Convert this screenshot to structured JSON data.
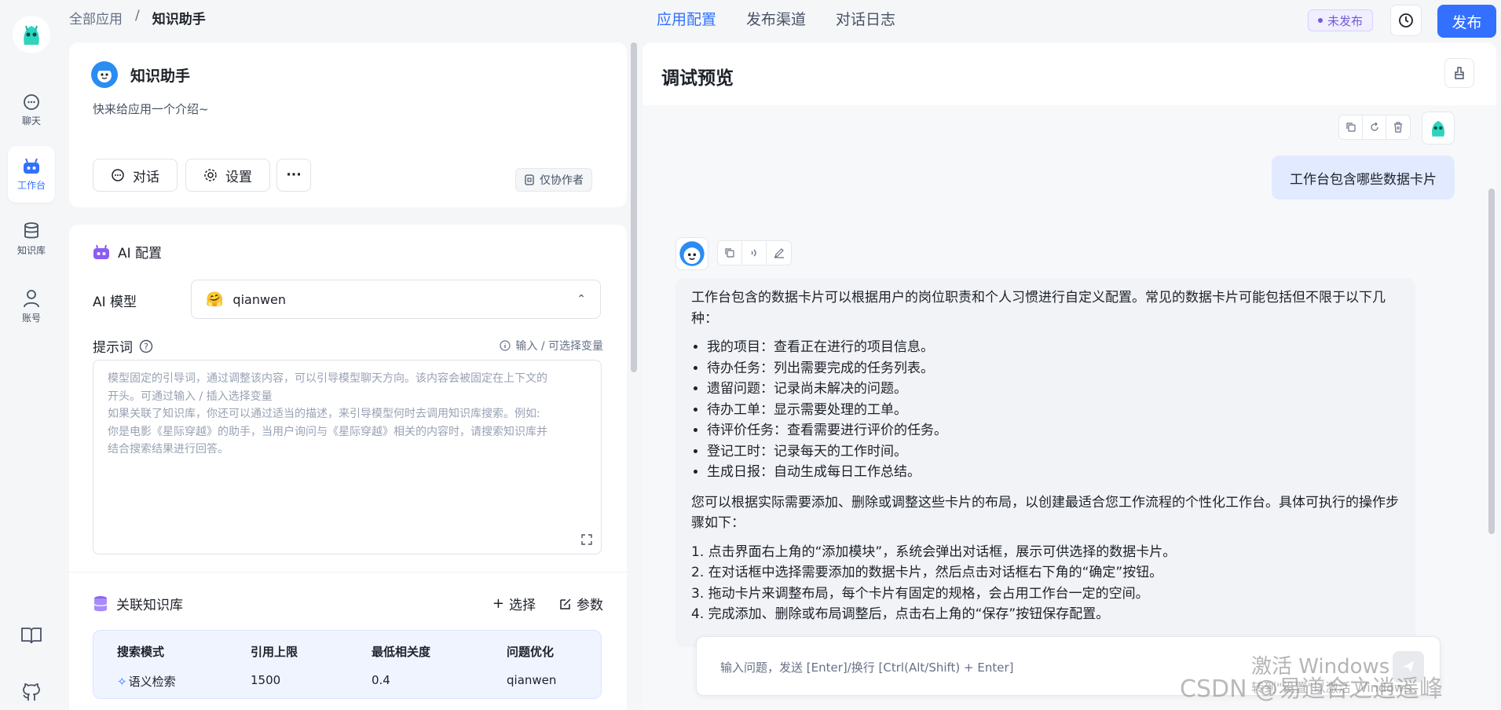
{
  "nav": {
    "items": [
      {
        "label": "聊天",
        "icon": "chat-icon"
      },
      {
        "label": "工作台",
        "icon": "robot-icon",
        "active": true
      },
      {
        "label": "知识库",
        "icon": "database-icon"
      },
      {
        "label": "账号",
        "icon": "user-icon"
      }
    ],
    "bottom_icons": [
      "book-icon",
      "github-icon"
    ]
  },
  "breadcrumb": {
    "root": "全部应用",
    "separator": "/",
    "current": "知识助手"
  },
  "top_tabs": [
    "应用配置",
    "发布渠道",
    "对话日志"
  ],
  "status": "未发布",
  "publish_label": "发布",
  "app": {
    "name": "知识助手",
    "description": "快来给应用一个介绍~",
    "buttons": {
      "chat": "对话",
      "settings": "设置",
      "more": "···"
    },
    "coauthor": "仅协作者"
  },
  "ai_config": {
    "title": "AI 配置",
    "model_label": "AI 模型",
    "model_value": "qianwen",
    "prompt_label": "提示词",
    "var_hint": "输入 / 可选择变量",
    "prompt_placeholder_1": "模型固定的引导词，通过调整该内容，可以引导模型聊天方向。该内容会被固定在上下文的",
    "prompt_placeholder_2": "开头。可通过输入 / 插入选择变量",
    "prompt_placeholder_3": "如果关联了知识库，你还可以通过适当的描述，来引导模型何时去调用知识库搜索。例如:",
    "prompt_placeholder_4": "你是电影《星际穿越》的助手，当用户询问与《星际穿越》相关的内容时，请搜索知识库并",
    "prompt_placeholder_5": "结合搜索结果进行回答。"
  },
  "knowledge": {
    "title": "关联知识库",
    "select_label": "选择",
    "params_label": "参数",
    "headers": [
      "搜索模式",
      "引用上限",
      "最低相关度",
      "问题优化"
    ],
    "values": [
      "语义检索",
      "1500",
      "0.4",
      "qianwen"
    ]
  },
  "preview": {
    "title": "调试预览",
    "user_message": "工作台包含哪些数据卡片",
    "bot_intro": "工作台包含的数据卡片可以根据用户的岗位职责和个人习惯进行自定义配置。常见的数据卡片可能包括但不限于以下几种：",
    "bot_list": [
      "我的项目：查看正在进行的项目信息。",
      "待办任务：列出需要完成的任务列表。",
      "遗留问题：记录尚未解决的问题。",
      "待办工单：显示需要处理的工单。",
      "待评价任务：查看需要进行评价的任务。",
      "登记工时：记录每天的工作时间。",
      "生成日报：自动生成每日工作总结。"
    ],
    "bot_para2": "您可以根据实际需要添加、删除或调整这些卡片的布局，以创建最适合您工作流程的个性化工作台。具体可执行的操作步骤如下：",
    "bot_steps": [
      "1. 点击界面右上角的“添加模块”，系统会弹出对话框，展示可供选择的数据卡片。",
      "2. 在对话框中选择需要添加的数据卡片，然后点击对话框右下角的“确定”按钮。",
      "3. 拖动卡片来调整布局，每个卡片有固定的规格，会占用工作台一定的空间。",
      "4. 完成添加、删除或布局调整后，点击右上角的“保存”按钮保存配置。"
    ],
    "input_placeholder": "输入问题，发送 [Enter]/换行 [Ctrl(Alt/Shift) + Enter]"
  },
  "watermarks": {
    "windows_1": "激活 Windows",
    "windows_2": "转到\"设置\"以激活 Windows。",
    "csdn": "CSDN @易道合之逍遥峰"
  }
}
